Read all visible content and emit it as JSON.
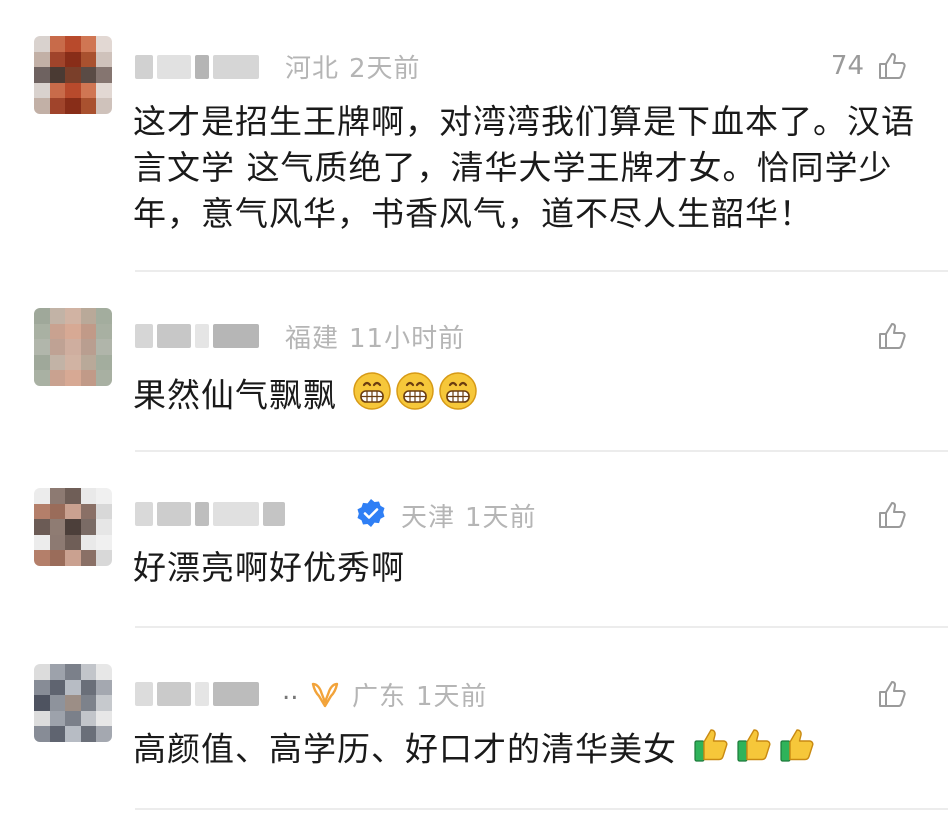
{
  "comments": [
    {
      "location": "河北",
      "time": "2天前",
      "likes": "74",
      "text": "这才是招生王牌啊，对湾湾我们算是下血本了。汉语言文学 这气质绝了，清华大学王牌才女。恰同学少年，意气风华，书香风气，道不尽人生韶华！",
      "avatar_colors": [
        "#d9d2ce",
        "#c86b4a",
        "#b84a2c",
        "#d07653",
        "#e2d8d3",
        "#c2b0a6",
        "#a0442b",
        "#882d18",
        "#a9512f",
        "#cfc2bb",
        "#6e6260",
        "#4a3a33",
        "#7a3f2a",
        "#5a4b45",
        "#857570"
      ],
      "name_blocks": [
        "#c9c9c9",
        "#dcdcdc",
        "#a8a8a8",
        "#cfcfcf"
      ]
    },
    {
      "location": "福建",
      "time": "11小时前",
      "likes": "",
      "text": "果然仙气飘飘",
      "emoji_count": 3,
      "avatar_colors": [
        "#9fa89a",
        "#c2b3a6",
        "#d1b3a3",
        "#b9a999",
        "#a3ad9e",
        "#a9b1a3",
        "#c9a290",
        "#d7a994",
        "#c19a88",
        "#a8b0a2",
        "#b1b6ab",
        "#bfa294",
        "#cfae9f",
        "#b99e90",
        "#b0b5aa"
      ],
      "name_blocks": [
        "#cfcfcf",
        "#bdbdbd",
        "#e0e0e0",
        "#a9a9a9"
      ]
    },
    {
      "location": "天津",
      "time": "1天前",
      "likes": "",
      "text": "好漂亮啊好优秀啊",
      "verified": true,
      "avatar_colors": [
        "#ececec",
        "#8d7a72",
        "#6f5e57",
        "#e9e9e9",
        "#f0f0f0",
        "#b47f6a",
        "#9a6c5a",
        "#caa190",
        "#8a7066",
        "#d8d8d8",
        "#6b5b55",
        "#8f7c73",
        "#4c3f3a",
        "#7a6b65",
        "#e6e6e6"
      ],
      "name_blocks": [
        "#d2d2d2",
        "#c4c4c4",
        "#b3b3b3",
        "#dadada",
        "#bababa"
      ]
    },
    {
      "location": "广东",
      "time": "1天前",
      "likes": "",
      "text": "高颜值、高学历、好口才的清华美女",
      "ellipsis": "..",
      "vip": true,
      "avatar_colors": [
        "#dcdcdc",
        "#9da2ab",
        "#7b808a",
        "#c2c5ca",
        "#e7e7e7",
        "#878c96",
        "#5f6470",
        "#b7bcc4",
        "#6a6f79",
        "#a4a8b0",
        "#4e5360",
        "#8e939c",
        "#9c8e86",
        "#7d828b",
        "#c6c9cd"
      ],
      "name_blocks": [
        "#d6d6d6",
        "#c1c1c1",
        "#e1e1e1",
        "#b0b0b0"
      ]
    }
  ],
  "colors": {
    "meta_text": "#b5b5b5",
    "body_text": "#1a1a1a",
    "verified_blue": "#2f7ff5",
    "vip_orange": "#f2a33a",
    "divider": "#ececec"
  }
}
